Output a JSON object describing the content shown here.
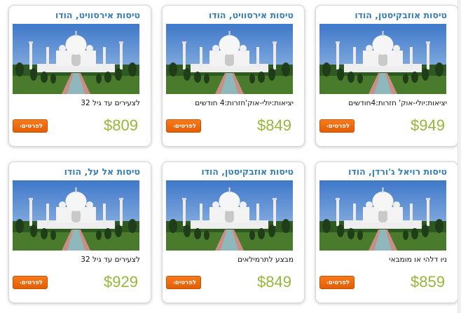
{
  "colors": {
    "title": "#3a7fb5",
    "price": "#95b73a",
    "button": "#f26f10"
  },
  "cards": [
    {
      "title": "טיסות אירסוויט, הודו",
      "desc": "לצעירים עד גיל 32",
      "price": "$809",
      "button_label": "לפרטים",
      "image_icon": "taj-mahal-photo"
    },
    {
      "title": "טיסות אירסוויט, הודו",
      "desc": "יציאות:יולי-אוק'חזרות:4 חודשים",
      "price": "$849",
      "button_label": "לפרטים",
      "image_icon": "taj-mahal-photo"
    },
    {
      "title": "טיסות אוזבקיסטן, הודו",
      "desc": "יציאות:יולי-אוק' חזרות:4חודשים",
      "price": "$949",
      "button_label": "לפרטים",
      "image_icon": "taj-mahal-photo"
    },
    {
      "title": "טיסות אל על, הודו",
      "desc": "לצעירים עד גיל 32",
      "price": "$929",
      "button_label": "לפרטים",
      "image_icon": "taj-mahal-photo"
    },
    {
      "title": "טיסות אוזבקיסטן, הודו",
      "desc": "מבצע לתרמילאים",
      "price": "$849",
      "button_label": "לפרטים",
      "image_icon": "taj-mahal-photo"
    },
    {
      "title": "טיסות רויאל ג'ורדן, הודו",
      "desc": "ניו דלהי או מומבאי",
      "price": "$859",
      "button_label": "לפרטים",
      "image_icon": "taj-mahal-photo"
    }
  ]
}
